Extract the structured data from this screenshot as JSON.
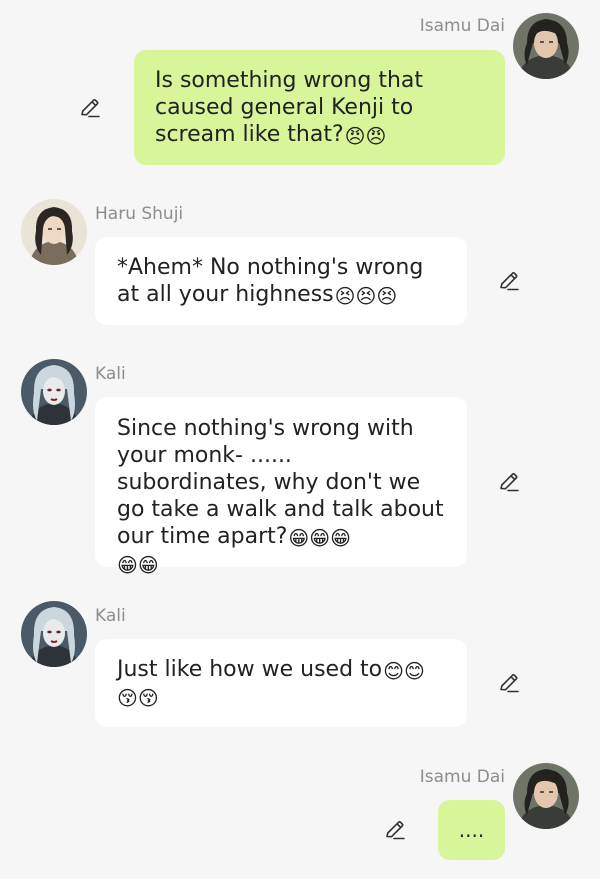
{
  "messages": [
    {
      "sender": "Isamu Dai",
      "text": "Is something wrong that caused general Kenji to scream like that?",
      "emojis": "😠😠",
      "side": "outgoing"
    },
    {
      "sender": "Haru Shuji",
      "text": "*Ahem* No nothing's wrong at all your highness",
      "emojis": "😣😣😣",
      "side": "incoming"
    },
    {
      "sender": "Kali",
      "text": "Since nothing's wrong with your monk- ...... subordinates, why don't we go take a walk and talk about our time apart?",
      "emojis": "😁😁😁",
      "emojis_line2": "😁😁",
      "side": "incoming"
    },
    {
      "sender": "Kali",
      "text": "Just like how we used to",
      "emojis": "😊😊",
      "emojis_line2": "😚😚",
      "side": "incoming"
    },
    {
      "sender": "Isamu Dai",
      "text": "....",
      "side": "outgoing"
    }
  ],
  "colors": {
    "background": "#f6f6f6",
    "outgoing_bubble": "#d8f59a",
    "incoming_bubble": "#ffffff",
    "name_text": "#8d8d8d",
    "message_text": "#222222"
  },
  "icons": {
    "edit": "pencil-edit-icon",
    "avatar_isamu": "avatar-isamu-dai",
    "avatar_haru": "avatar-haru-shuji",
    "avatar_kali": "avatar-kali"
  }
}
